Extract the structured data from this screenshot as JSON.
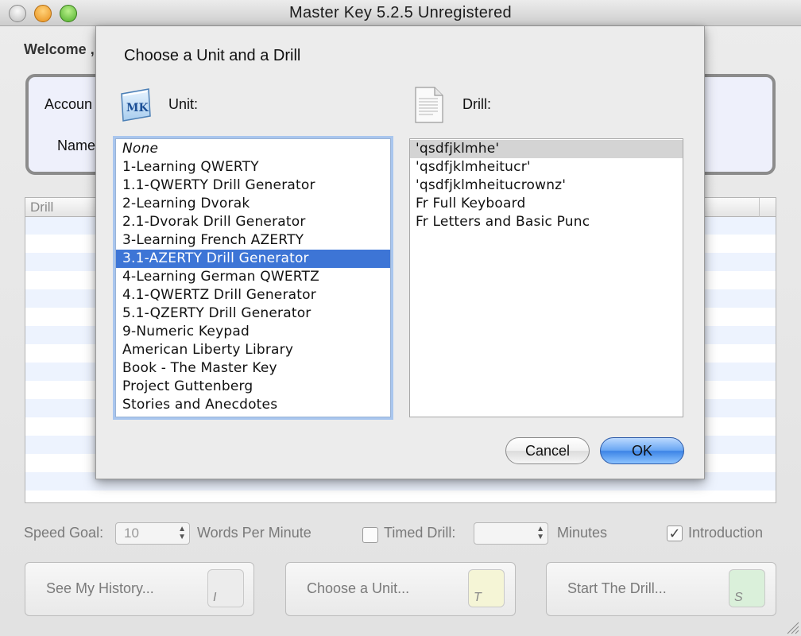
{
  "window": {
    "title": "Master Key 5.2.5 Unregistered"
  },
  "main": {
    "welcome": "Welcome ,",
    "account_label": "Accoun",
    "name_label": "Name",
    "drill_column_header": "Drill"
  },
  "controls": {
    "speed_goal_label": "Speed Goal:",
    "speed_goal_value": "10",
    "wpm_label": "Words Per Minute",
    "timed_drill_label": "Timed Drill:",
    "timed_drill_checked": false,
    "minutes_value": "",
    "minutes_label": "Minutes",
    "introduction_label": "Introduction",
    "introduction_checked": true
  },
  "buttons": {
    "history": {
      "label": "See My History...",
      "key": "I",
      "key_color": "#ececec"
    },
    "choose_unit": {
      "label": "Choose a Unit...",
      "key": "T",
      "key_color": "#f5f5d6"
    },
    "start_drill": {
      "label": "Start The Drill...",
      "key": "S",
      "key_color": "#daf0da"
    }
  },
  "dialog": {
    "title": "Choose a Unit and a Drill",
    "unit_label": "Unit:",
    "drill_label": "Drill:",
    "units": [
      "None",
      "1-Learning QWERTY",
      "1.1-QWERTY Drill Generator",
      "2-Learning Dvorak",
      "2.1-Dvorak Drill Generator",
      "3-Learning French AZERTY",
      "3.1-AZERTY Drill Generator",
      "4-Learning German QWERTZ",
      "4.1-QWERTZ Drill Generator",
      "5.1-QZERTY Drill Generator",
      "9-Numeric Keypad",
      "American Liberty Library",
      "Book - The Master Key",
      "Project Guttenberg",
      "Stories and Anecdotes"
    ],
    "selected_unit": "3.1-AZERTY Drill Generator",
    "drills": [
      "'qsdfjklmhe'",
      "'qsdfjklmheitucr'",
      "'qsdfjklmheitucrownz'",
      "Fr Full Keyboard",
      "Fr Letters and Basic Punc"
    ],
    "selected_drill": "'qsdfjklmhe'",
    "cancel_label": "Cancel",
    "ok_label": "OK",
    "selection_color": "#3d75d6",
    "ok_color": "#5a9cf0"
  }
}
